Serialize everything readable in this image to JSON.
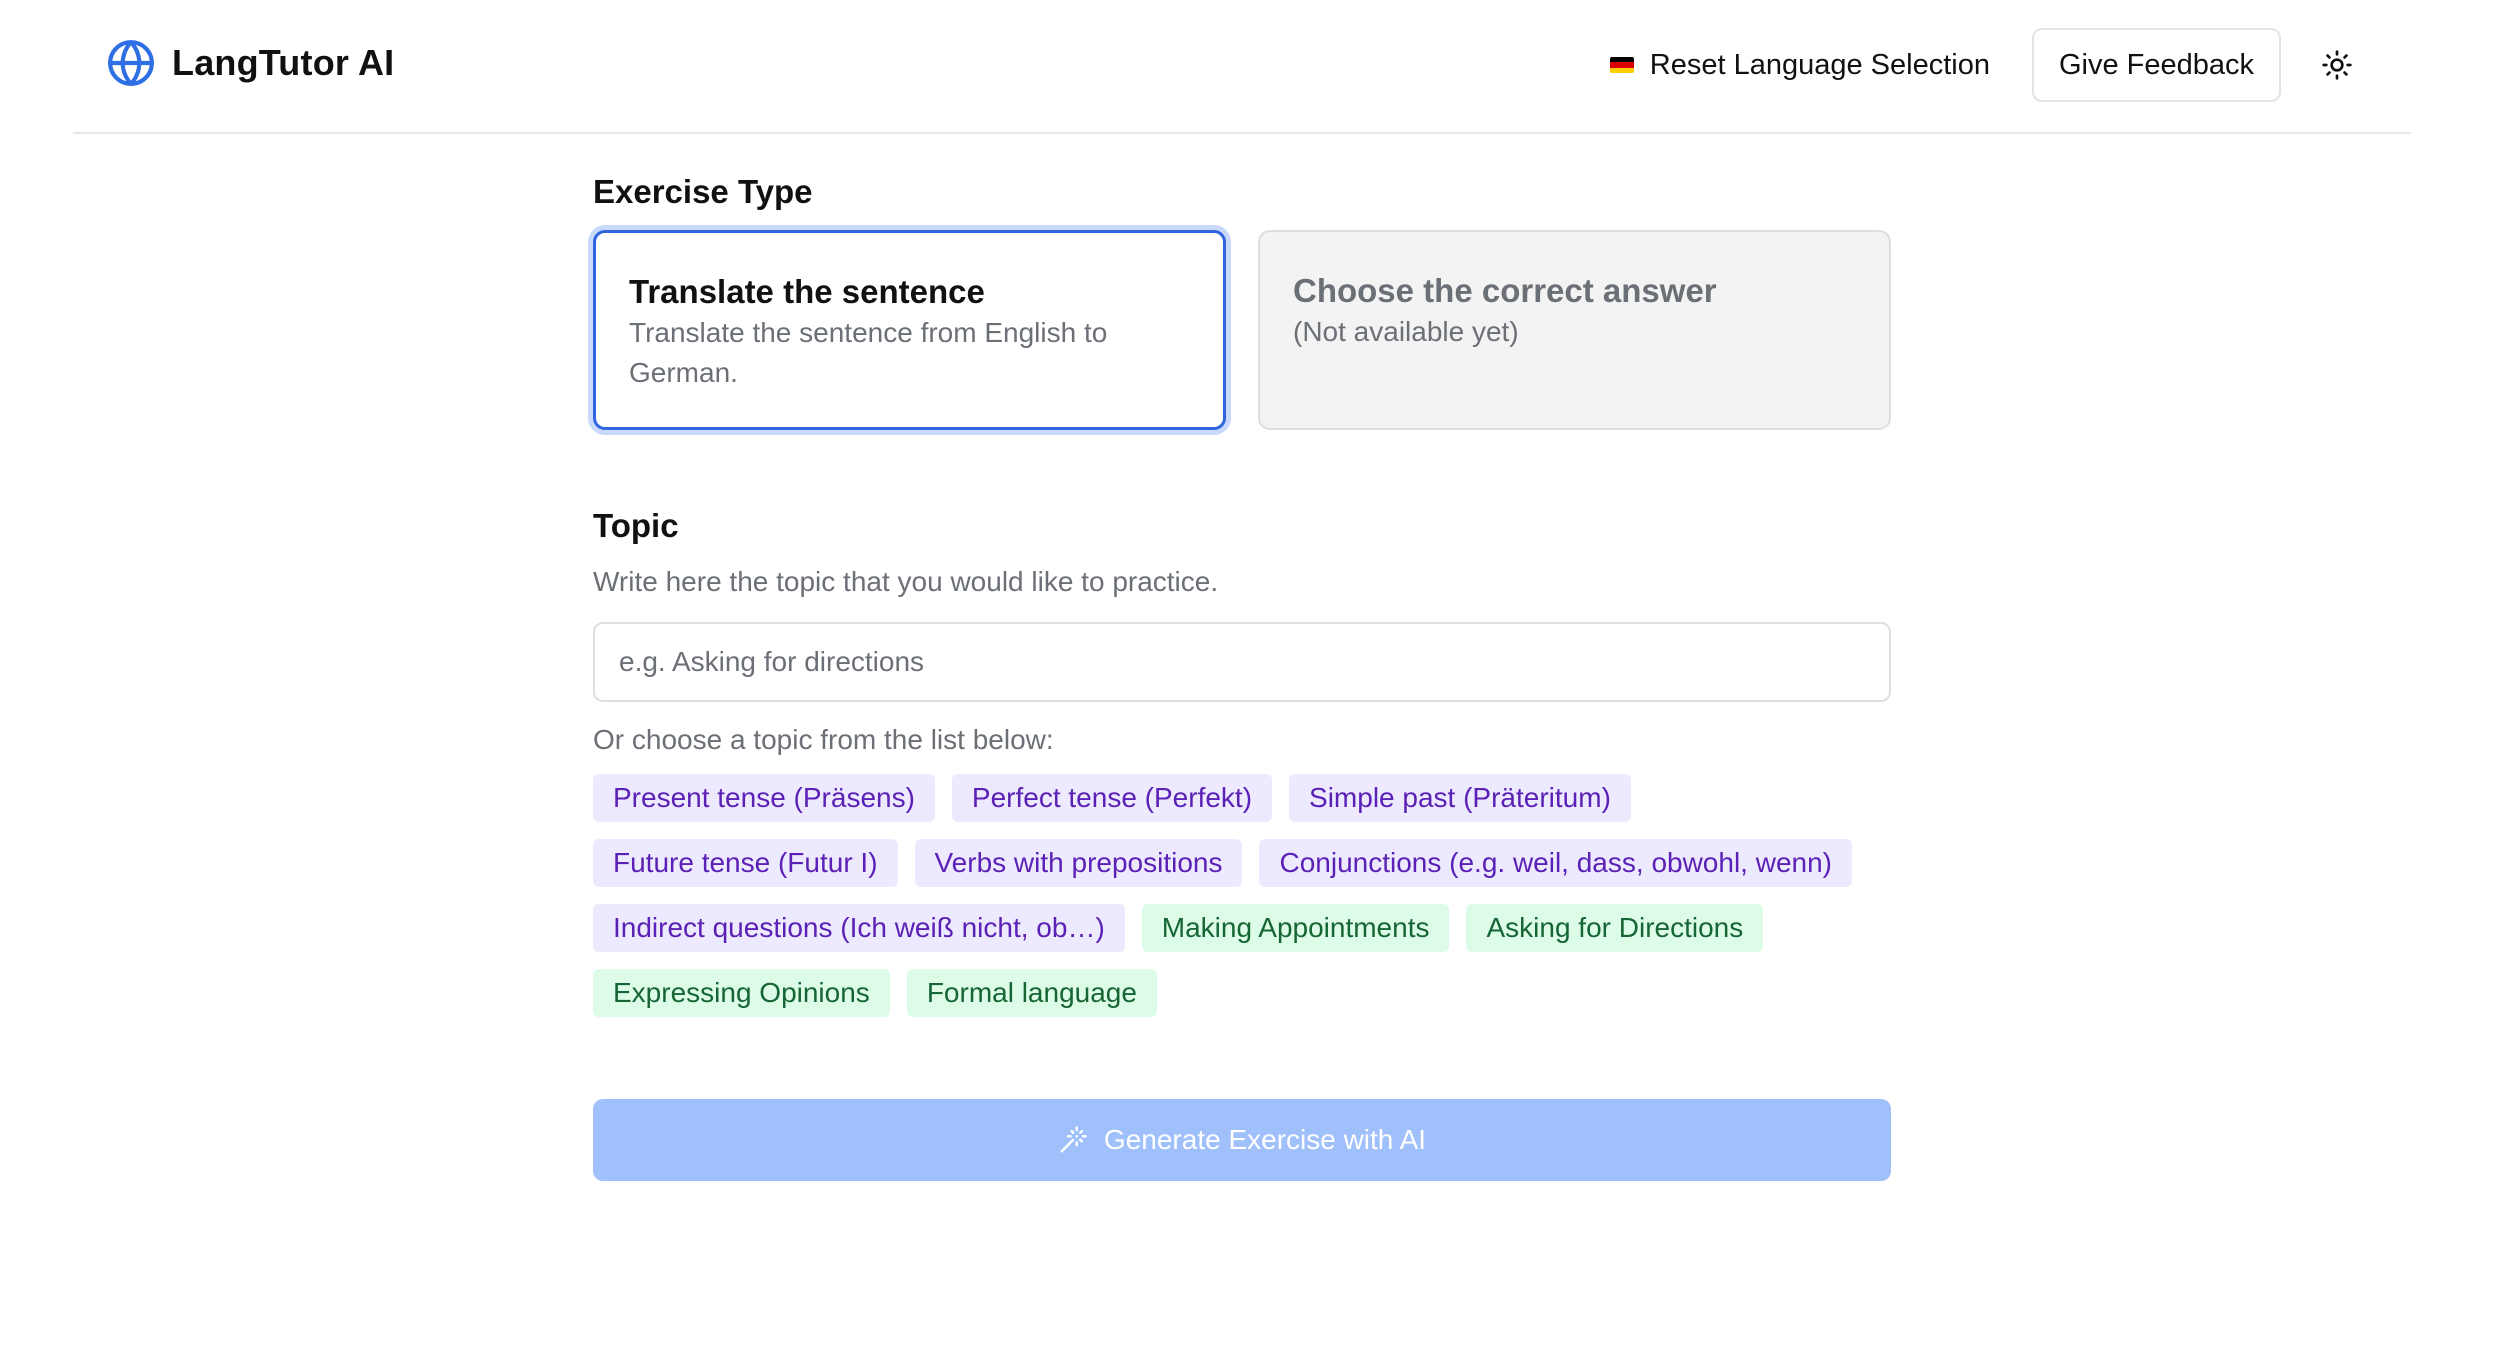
{
  "header": {
    "app_title": "LangTutor AI",
    "logo_icon": "globe-icon",
    "reset_label": "Reset Language Selection",
    "reset_flag": "flag-de-icon",
    "feedback_label": "Give Feedback",
    "theme_icon": "sun-icon"
  },
  "colors": {
    "accent": "#2f66e0",
    "generate_button_disabled": "#9fc0fb",
    "grammar_chip_bg": "#ede9fe",
    "grammar_chip_text": "#5b21b6",
    "situation_chip_bg": "#dcfce7",
    "situation_chip_text": "#166534"
  },
  "exercise_type": {
    "heading": "Exercise Type",
    "options": [
      {
        "title": "Translate the sentence",
        "description": "Translate the sentence from English to German.",
        "selected": true,
        "available": true
      },
      {
        "title": "Choose the correct answer",
        "description": "(Not available yet)",
        "selected": false,
        "available": false
      }
    ]
  },
  "topic": {
    "heading": "Topic",
    "help_text": "Write here the topic that you would like to practice.",
    "input_value": "",
    "input_placeholder": "e.g. Asking for directions",
    "choose_label": "Or choose a topic from the list below:",
    "chips": [
      {
        "label": "Present tense (Präsens)",
        "kind": "grammar"
      },
      {
        "label": "Perfect tense (Perfekt)",
        "kind": "grammar"
      },
      {
        "label": "Simple past (Präteritum)",
        "kind": "grammar"
      },
      {
        "label": "Future tense (Futur I)",
        "kind": "grammar"
      },
      {
        "label": "Verbs with prepositions",
        "kind": "grammar"
      },
      {
        "label": "Conjunctions (e.g. weil, dass, obwohl, wenn)",
        "kind": "grammar"
      },
      {
        "label": "Indirect questions (Ich weiß nicht, ob…)",
        "kind": "grammar"
      },
      {
        "label": "Making Appointments",
        "kind": "situation"
      },
      {
        "label": "Asking for Directions",
        "kind": "situation"
      },
      {
        "label": "Expressing Opinions",
        "kind": "situation"
      },
      {
        "label": "Formal language",
        "kind": "situation"
      }
    ]
  },
  "generate": {
    "label": "Generate Exercise with AI",
    "icon": "magic-wand-icon",
    "enabled": false
  }
}
